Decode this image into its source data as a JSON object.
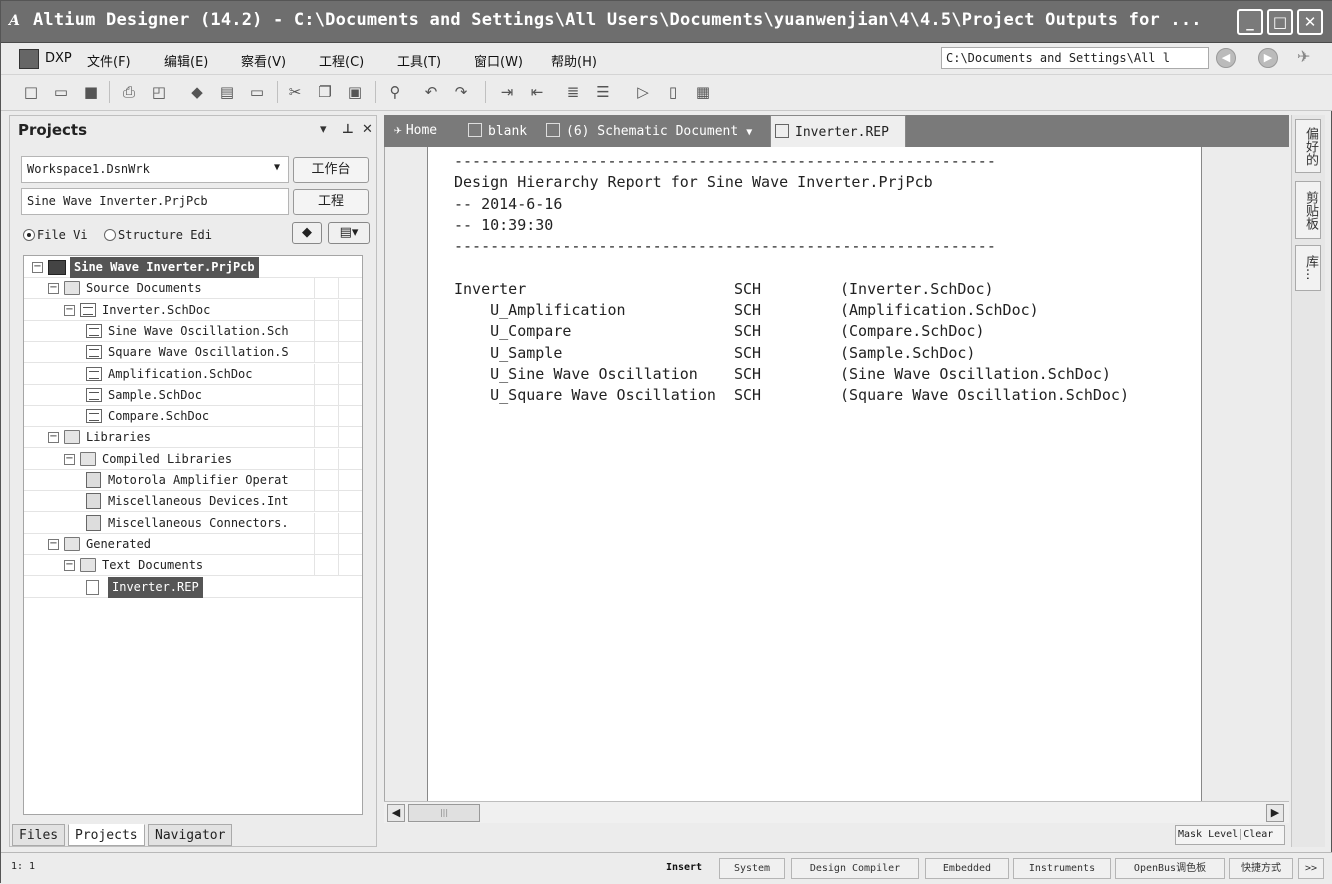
{
  "window": {
    "title": "Altium Designer (14.2) - C:\\Documents and Settings\\All Users\\Documents\\yuanwenjian\\4\\4.5\\Project Outputs for ...",
    "app_icon": "A"
  },
  "menu": {
    "items": [
      "DXP",
      "文件(F)",
      "编辑(E)",
      "察看(V)",
      "工程(C)",
      "工具(T)",
      "窗口(W)",
      "帮助(H)"
    ],
    "path": "C:\\Documents and Settings\\All l"
  },
  "projects_panel": {
    "title": "Projects",
    "workspace": "Workspace1.DsnWrk",
    "workspace_button": "工作台",
    "project": "Sine Wave Inverter.PrjPcb",
    "project_button": "工程",
    "radio_file_view": "File Vi",
    "radio_structure": "Structure Edi",
    "tree": [
      {
        "label": "Sine Wave Inverter.PrjPcb",
        "level": 0,
        "icon": "project-icon"
      },
      {
        "label": "Source Documents",
        "level": 1,
        "icon": "folder-icon"
      },
      {
        "label": "Inverter.SchDoc",
        "level": 2,
        "icon": "schematic-icon"
      },
      {
        "label": "Sine Wave Oscillation.Sch",
        "level": 3,
        "icon": "schematic-icon"
      },
      {
        "label": "Square Wave Oscillation.S",
        "level": 3,
        "icon": "schematic-icon"
      },
      {
        "label": "Amplification.SchDoc",
        "level": 3,
        "icon": "schematic-icon"
      },
      {
        "label": "Sample.SchDoc",
        "level": 3,
        "icon": "schematic-icon"
      },
      {
        "label": "Compare.SchDoc",
        "level": 3,
        "icon": "schematic-icon"
      },
      {
        "label": "Libraries",
        "level": 1,
        "icon": "folder-icon"
      },
      {
        "label": "Compiled Libraries",
        "level": 2,
        "icon": "folder-icon"
      },
      {
        "label": "Motorola Amplifier Operat",
        "level": 3,
        "icon": "library-icon"
      },
      {
        "label": "Miscellaneous Devices.Int",
        "level": 3,
        "icon": "library-icon"
      },
      {
        "label": "Miscellaneous Connectors.",
        "level": 3,
        "icon": "library-icon"
      },
      {
        "label": "Generated",
        "level": 1,
        "icon": "folder-icon"
      },
      {
        "label": "Text Documents",
        "level": 2,
        "icon": "folder-icon"
      },
      {
        "label": "Inverter.REP",
        "level": 3,
        "icon": "text-doc-icon"
      }
    ],
    "bottom_tabs": [
      "Files",
      "Projects",
      "Navigator"
    ]
  },
  "doc_tabs": [
    {
      "label": "Home",
      "icon": "home-icon"
    },
    {
      "label": "blank",
      "icon": "doc-icon"
    },
    {
      "label": "(6) Schematic Document",
      "icon": "schematic-icon"
    },
    {
      "label": "Inverter.REP",
      "icon": "text-doc-icon"
    }
  ],
  "report": {
    "separator": "------------------------------------------------------------",
    "title": "Design Hierarchy Report for Sine Wave Inverter.PrjPcb",
    "date": "-- 2014-6-16",
    "time": "-- 10:39:30",
    "rows": [
      {
        "name": "Inverter",
        "kind": "SCH",
        "file": "(Inverter.SchDoc)"
      },
      {
        "name": "    U_Amplification",
        "kind": "SCH",
        "file": "(Amplification.SchDoc)"
      },
      {
        "name": "    U_Compare",
        "kind": "SCH",
        "file": "(Compare.SchDoc)"
      },
      {
        "name": "    U_Sample",
        "kind": "SCH",
        "file": "(Sample.SchDoc)"
      },
      {
        "name": "    U_Sine Wave Oscillation",
        "kind": "SCH",
        "file": "(Sine Wave Oscillation.SchDoc)"
      },
      {
        "name": "    U_Square Wave Oscillation",
        "kind": "SCH",
        "file": "(Square Wave Oscillation.SchDoc)"
      }
    ]
  },
  "mask_level": "Mask Level",
  "clear": "Clear",
  "right_panels": [
    "偏好的",
    "剪贴板",
    "库..."
  ],
  "status": {
    "position": "1: 1",
    "insert": "Insert",
    "buttons": [
      "System",
      "Design Compiler",
      "Embedded",
      "Instruments",
      "OpenBus调色板",
      "快捷方式",
      ">>"
    ]
  }
}
